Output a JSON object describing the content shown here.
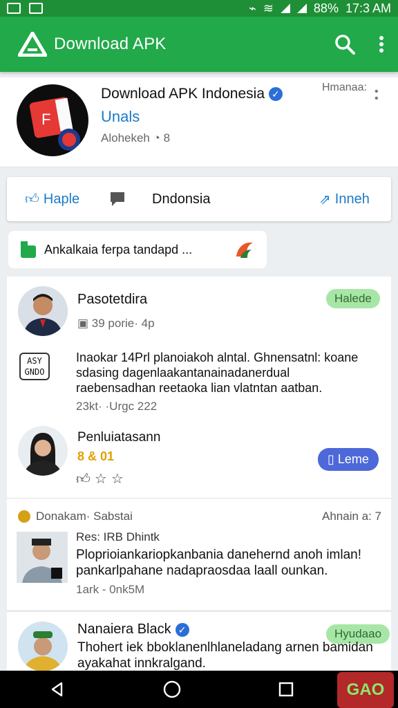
{
  "status_bar": {
    "battery": "88%",
    "time": "17:3 AM"
  },
  "app_bar": {
    "title": "Download APK"
  },
  "profile": {
    "name": "Download APK Indonesia",
    "subtitle": "Unals",
    "meta": "Alohekeh",
    "meta_count": "8",
    "menu_label": "Hmanaa:"
  },
  "tabs": {
    "home_label": "Haple",
    "center_label": "Dndonsia",
    "right_label": "Inneh"
  },
  "chip": {
    "text": "Ankalkaia ferpa tandapd ..."
  },
  "post1": {
    "author": "Pasotetdira",
    "badge": "Halede",
    "meta": "39 porie· 4p",
    "tag_label_top": "ASY",
    "tag_label_bottom": "GNDO",
    "body": "Inaokar 14Prl planoiakoh alntal. Ghnensatnl: koane sdasing dagenlaakantanainadanerdual raebensadhan reetaoka lian vlatntan aatban.",
    "stats": "23kt· ·Urgc 222"
  },
  "post2": {
    "author": "Penluiatasann",
    "rating": "8 & 01",
    "button": "Leme"
  },
  "section2": {
    "header": "Donakam· Sabstai",
    "right_label": "Ahnain a: 7",
    "title": "Res: IRB Dhintk",
    "body": "Ploprioiankariopkanbania danehernd anoh imlan! pankarlpahane nadapraosdaa laall ounkan.",
    "meta": "1ark - 0nk5M"
  },
  "section3": {
    "author": "Nanaiera Black",
    "badge": "Hyudaao",
    "body": "Thohert iek bboklanenlhlaneladang arnen bamidan ayakahat innkralgand."
  },
  "corner_badge": "GAO"
}
